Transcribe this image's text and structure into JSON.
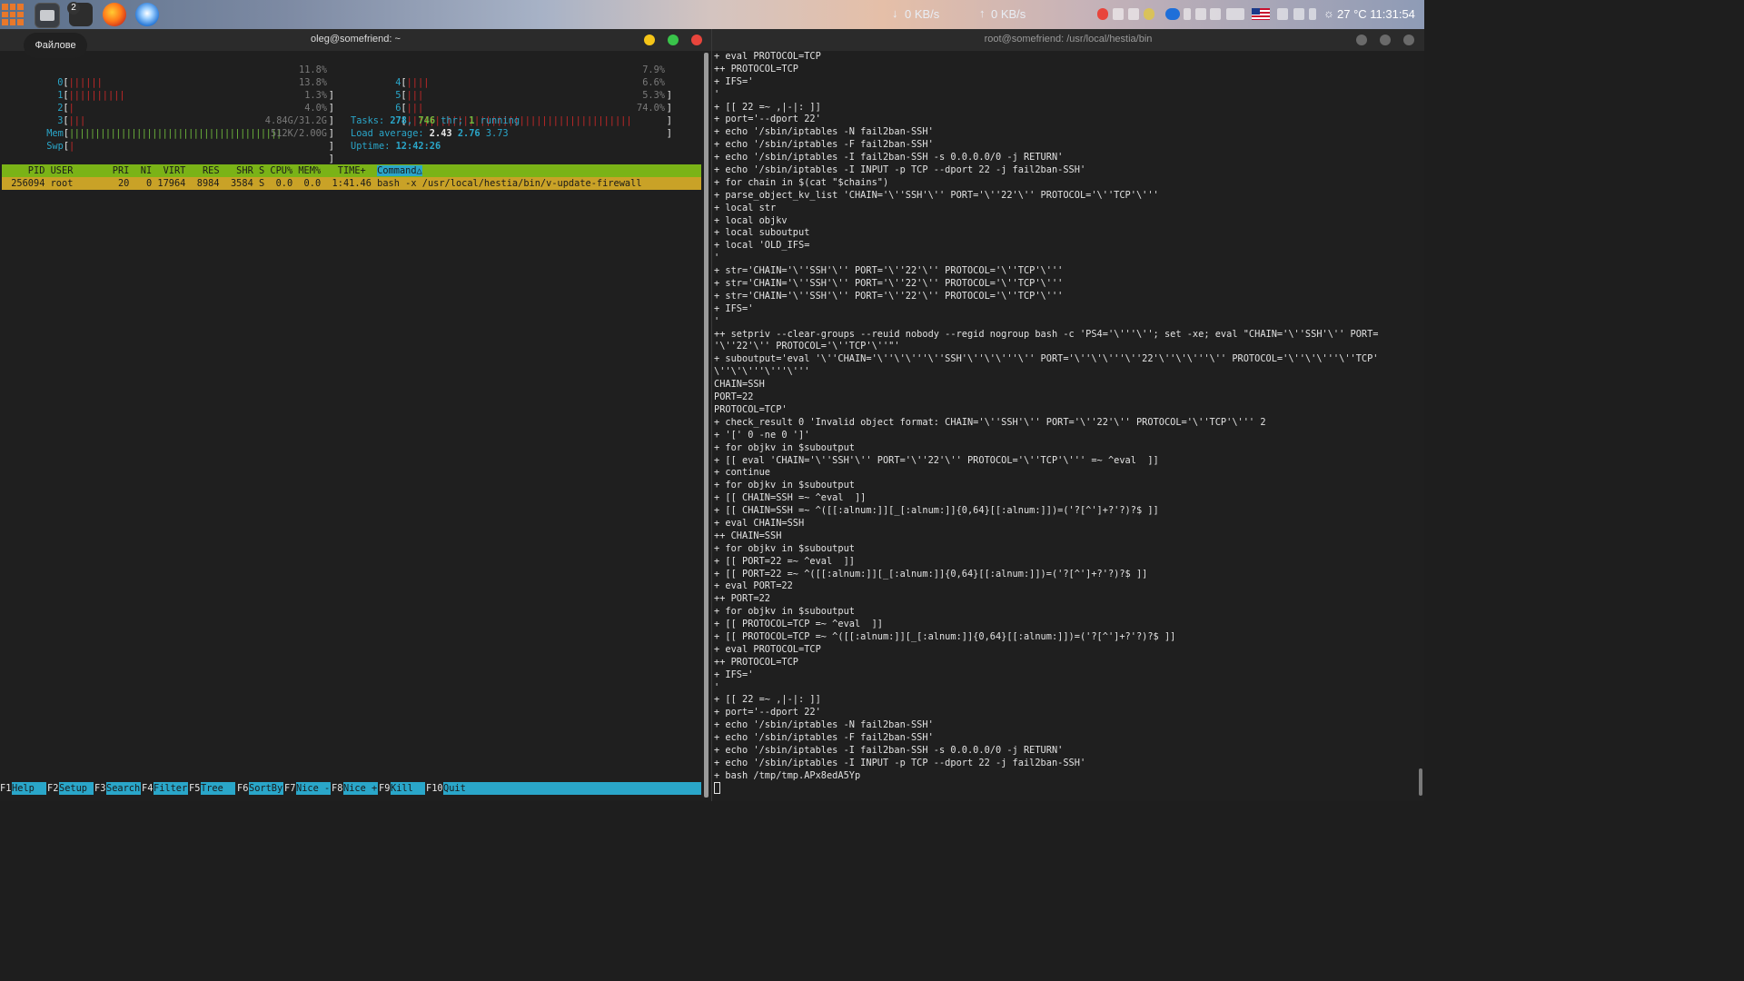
{
  "taskbar": {
    "tooltip": "Файлове",
    "terminal_badge": "2",
    "net_down": "0 KB/s",
    "net_up": "0 KB/s",
    "temp_time": "27 °C 11:31:54"
  },
  "left_window": {
    "title": "oleg@somefriend: ~",
    "cpu": [
      {
        "label": "0",
        "value": "11.8%",
        "bar": "||||||"
      },
      {
        "label": "1",
        "value": "13.8%",
        "bar": "||||||||||"
      },
      {
        "label": "2",
        "value": "1.3%",
        "bar": "|"
      },
      {
        "label": "3",
        "value": "4.0%",
        "bar": "|||"
      },
      {
        "label": "4",
        "value": "7.9%",
        "bar": "||||"
      },
      {
        "label": "5",
        "value": "6.6%",
        "bar": "|||"
      },
      {
        "label": "6",
        "value": "5.3%",
        "bar": "|||"
      },
      {
        "label": "7",
        "value": "74.0%",
        "bar": "||||||||||||||||||||||||||||||||||||||||"
      }
    ],
    "mem": {
      "label": "Mem",
      "value": "4.84G/31.2G",
      "bar": "|||||||||||||||||||||||||||||||||||||||||"
    },
    "swp": {
      "label": "Swp",
      "value": "512K/2.00G",
      "bar": "|"
    },
    "tasks": {
      "label": "Tasks: ",
      "count": "278",
      "sep": ", ",
      "thr": "746",
      "thr_label": " thr; ",
      "running": "1",
      "running_label": " running"
    },
    "load": {
      "label": "Load average: ",
      "l1": "2.43",
      "l5": "2.76",
      "l15": "3.73"
    },
    "uptime": {
      "label": "Uptime: ",
      "value": "12:42:26"
    },
    "header_cols": "    PID USER       PRI  NI  VIRT   RES   SHR S CPU% MEM%   TIME+  ",
    "sort_col": "Command△",
    "process_row": " 256094 root        20   0 17964  8984  3584 S  0.0  0.0  1:41.46 bash -x /usr/local/hestia/bin/v-update-firewall",
    "fkeys": [
      {
        "key": "F1",
        "label": "Help  "
      },
      {
        "key": "F2",
        "label": "Setup "
      },
      {
        "key": "F3",
        "label": "Search"
      },
      {
        "key": "F4",
        "label": "Filter"
      },
      {
        "key": "F5",
        "label": "Tree  "
      },
      {
        "key": "F6",
        "label": "SortBy"
      },
      {
        "key": "F7",
        "label": "Nice -"
      },
      {
        "key": "F8",
        "label": "Nice +"
      },
      {
        "key": "F9",
        "label": "Kill  "
      },
      {
        "key": "F10",
        "label": "Quit  "
      }
    ]
  },
  "right_window": {
    "title": "root@somefriend: /usr/local/hestia/bin",
    "lines": [
      "+ eval PROTOCOL=TCP",
      "++ PROTOCOL=TCP",
      "+ IFS='",
      "'",
      "+ [[ 22 =~ ,|-|: ]]",
      "+ port='--dport 22'",
      "+ echo '/sbin/iptables -N fail2ban-SSH'",
      "+ echo '/sbin/iptables -F fail2ban-SSH'",
      "+ echo '/sbin/iptables -I fail2ban-SSH -s 0.0.0.0/0 -j RETURN'",
      "+ echo '/sbin/iptables -I INPUT -p TCP --dport 22 -j fail2ban-SSH'",
      "+ for chain in $(cat \"$chains\")",
      "+ parse_object_kv_list 'CHAIN='\\''SSH'\\'' PORT='\\''22'\\'' PROTOCOL='\\''TCP'\\'''",
      "+ local str",
      "+ local objkv",
      "+ local suboutput",
      "+ local 'OLD_IFS=",
      "'",
      "+ str='CHAIN='\\''SSH'\\'' PORT='\\''22'\\'' PROTOCOL='\\''TCP'\\'''",
      "+ str='CHAIN='\\''SSH'\\'' PORT='\\''22'\\'' PROTOCOL='\\''TCP'\\'''",
      "+ str='CHAIN='\\''SSH'\\'' PORT='\\''22'\\'' PROTOCOL='\\''TCP'\\'''",
      "+ IFS='",
      "'",
      "++ setpriv --clear-groups --reuid nobody --regid nogroup bash -c 'PS4='\\'''\\''; set -xe; eval \"CHAIN='\\''SSH'\\'' PORT=",
      "'\\''22'\\'' PROTOCOL='\\''TCP'\\''\"'",
      "+ suboutput='eval '\\''CHAIN='\\''\\'\\'''\\''SSH'\\''\\'\\'''\\'' PORT='\\''\\'\\'''\\''22'\\''\\'\\'''\\'' PROTOCOL='\\''\\'\\'''\\''TCP'",
      "\\''\\'\\'''\\'''\\'''",
      "CHAIN=SSH",
      "PORT=22",
      "PROTOCOL=TCP'",
      "+ check_result 0 'Invalid object format: CHAIN='\\''SSH'\\'' PORT='\\''22'\\'' PROTOCOL='\\''TCP'\\''' 2",
      "+ '[' 0 -ne 0 ']'",
      "+ for objkv in $suboutput",
      "+ [[ eval 'CHAIN='\\''SSH'\\'' PORT='\\''22'\\'' PROTOCOL='\\''TCP'\\''' =~ ^eval  ]]",
      "+ continue",
      "+ for objkv in $suboutput",
      "+ [[ CHAIN=SSH =~ ^eval  ]]",
      "+ [[ CHAIN=SSH =~ ^([[:alnum:]][_[:alnum:]]{0,64}[[:alnum:]])=('?[^']+?'?)?$ ]]",
      "+ eval CHAIN=SSH",
      "++ CHAIN=SSH",
      "+ for objkv in $suboutput",
      "+ [[ PORT=22 =~ ^eval  ]]",
      "+ [[ PORT=22 =~ ^([[:alnum:]][_[:alnum:]]{0,64}[[:alnum:]])=('?[^']+?'?)?$ ]]",
      "+ eval PORT=22",
      "++ PORT=22",
      "+ for objkv in $suboutput",
      "+ [[ PROTOCOL=TCP =~ ^eval  ]]",
      "+ [[ PROTOCOL=TCP =~ ^([[:alnum:]][_[:alnum:]]{0,64}[[:alnum:]])=('?[^']+?'?)?$ ]]",
      "+ eval PROTOCOL=TCP",
      "++ PROTOCOL=TCP",
      "+ IFS='",
      "'",
      "+ [[ 22 =~ ,|-|: ]]",
      "+ port='--dport 22'",
      "+ echo '/sbin/iptables -N fail2ban-SSH'",
      "+ echo '/sbin/iptables -F fail2ban-SSH'",
      "+ echo '/sbin/iptables -I fail2ban-SSH -s 0.0.0.0/0 -j RETURN'",
      "+ echo '/sbin/iptables -I INPUT -p TCP --dport 22 -j fail2ban-SSH'",
      "+ bash /tmp/tmp.APx8edA5Yp"
    ]
  },
  "colors": {
    "htop_cyan": "#2aa6c9",
    "htop_header_green": "#7ab317",
    "htop_selected_row": "#c9a227",
    "close_red": "#e8453c",
    "minimize_yellow": "#f5c518",
    "maximize_green": "#39c44a"
  }
}
